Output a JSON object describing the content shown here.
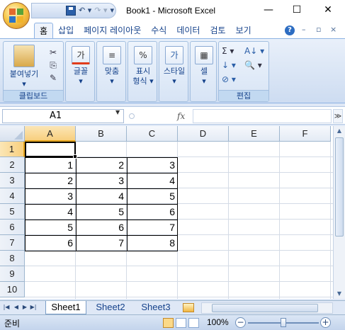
{
  "window": {
    "title": "Book1 - Microsoft Excel",
    "controls": {
      "minimize": "—",
      "maximize": "☐",
      "close": "✕"
    }
  },
  "qat": {
    "save": "save-icon",
    "undo": "↶ ▾",
    "redo": "↷ ▾",
    "customize": "▾"
  },
  "tabs": [
    "홈",
    "삽입",
    "페이지 레이아웃",
    "수식",
    "데이터",
    "검토",
    "보기"
  ],
  "active_tab": "홈",
  "ribbon_controls": {
    "help": "?",
    "minimize": "–",
    "restore": "▫",
    "close": "×"
  },
  "ribbon": {
    "clipboard": {
      "paste": "붙여넣기",
      "paste_arrow": "▾",
      "label": "클립보드"
    },
    "font": {
      "label": "글꼴",
      "icon": "가"
    },
    "alignment": {
      "label": "맞춤",
      "icon": "≡"
    },
    "number": {
      "label": "표시\n형식",
      "label_1": "표시",
      "label_2": "형식 ▾",
      "icon": "%"
    },
    "styles": {
      "label": "스타일",
      "icon": "가"
    },
    "cells": {
      "label": "셀",
      "icon": "▦"
    },
    "editing": {
      "label": "편집",
      "sum": "Σ ▾",
      "fill": "↓ ▾",
      "clear": "⊘ ▾",
      "sort": "A↓ ▾",
      "find": "🔍 ▾"
    }
  },
  "formula_bar": {
    "name_box": "A1",
    "fx": "fx",
    "formula": "",
    "expand": "≫"
  },
  "columns": [
    "A",
    "B",
    "C",
    "D",
    "E",
    "F"
  ],
  "rows": [
    "1",
    "2",
    "3",
    "4",
    "5",
    "6",
    "7",
    "8",
    "9",
    "10"
  ],
  "selected_cell": "A1",
  "cells": [
    [
      "1",
      "2",
      "3"
    ],
    [
      "2",
      "3",
      "4"
    ],
    [
      "3",
      "4",
      "5"
    ],
    [
      "4",
      "5",
      "6"
    ],
    [
      "5",
      "6",
      "7"
    ],
    [
      "6",
      "7",
      "8"
    ]
  ],
  "sheets": [
    "Sheet1",
    "Sheet2",
    "Sheet3"
  ],
  "active_sheet": "Sheet1",
  "status": {
    "text": "준비",
    "zoom": "100%",
    "zoom_out": "−",
    "zoom_in": "+"
  }
}
